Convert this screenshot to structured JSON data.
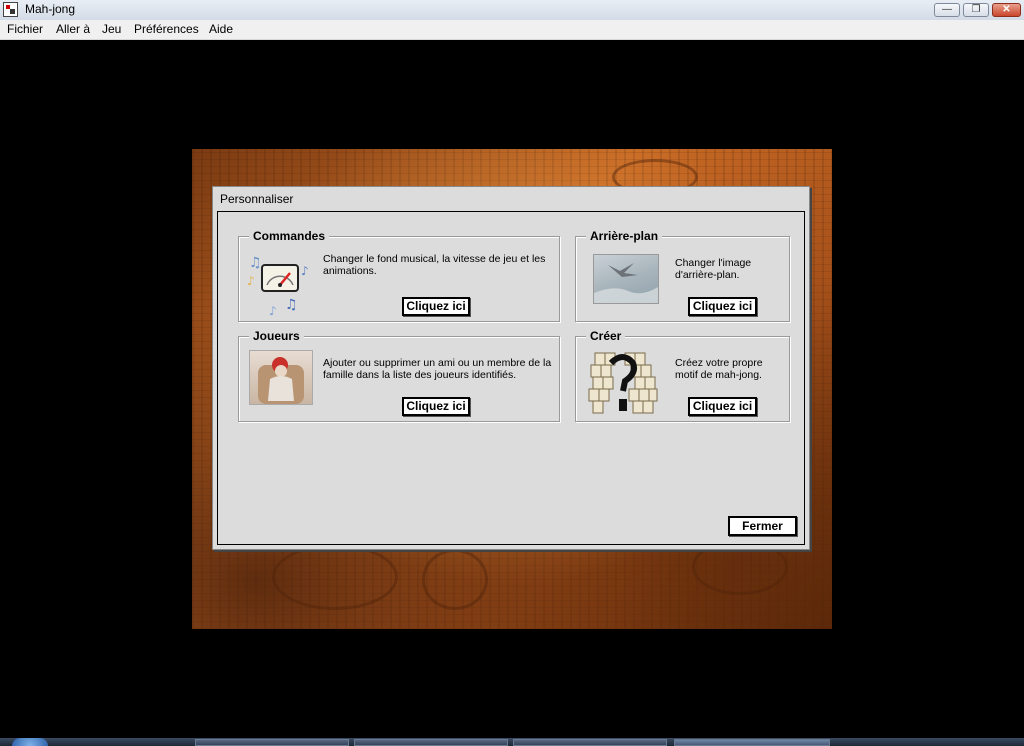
{
  "window": {
    "title": "Mah-jong",
    "icon": "mahjong-app-icon",
    "controls": [
      "minimize",
      "maximize",
      "close"
    ]
  },
  "menu": [
    "Fichier",
    "Aller à",
    "Jeu",
    "Préférences",
    "Aide"
  ],
  "dialog": {
    "title": "Personnaliser",
    "close_label": "Fermer",
    "groups": {
      "commandes": {
        "title": "Commandes",
        "description": "Changer le fond musical, la vitesse de jeu et les animations.",
        "button": "Cliquez ici",
        "icon": "gauge-music-icon"
      },
      "arriere_plan": {
        "title": "Arrière-plan",
        "description": "Changer l'image d'arrière-plan.",
        "button": "Cliquez ici",
        "icon": "background-image-icon"
      },
      "joueurs": {
        "title": "Joueurs",
        "description": "Ajouter ou supprimer un ami ou un membre de la famille dans la liste des joueurs identifiés.",
        "button": "Cliquez ici",
        "icon": "player-portrait-icon"
      },
      "creer": {
        "title": "Créer",
        "description": "Créez votre propre motif de mah-jong.",
        "button": "Cliquez ici",
        "icon": "tile-layout-question-icon"
      }
    }
  },
  "colors": {
    "dialog_bg": "#dcdcdc",
    "background_wood": "#c86a25"
  }
}
